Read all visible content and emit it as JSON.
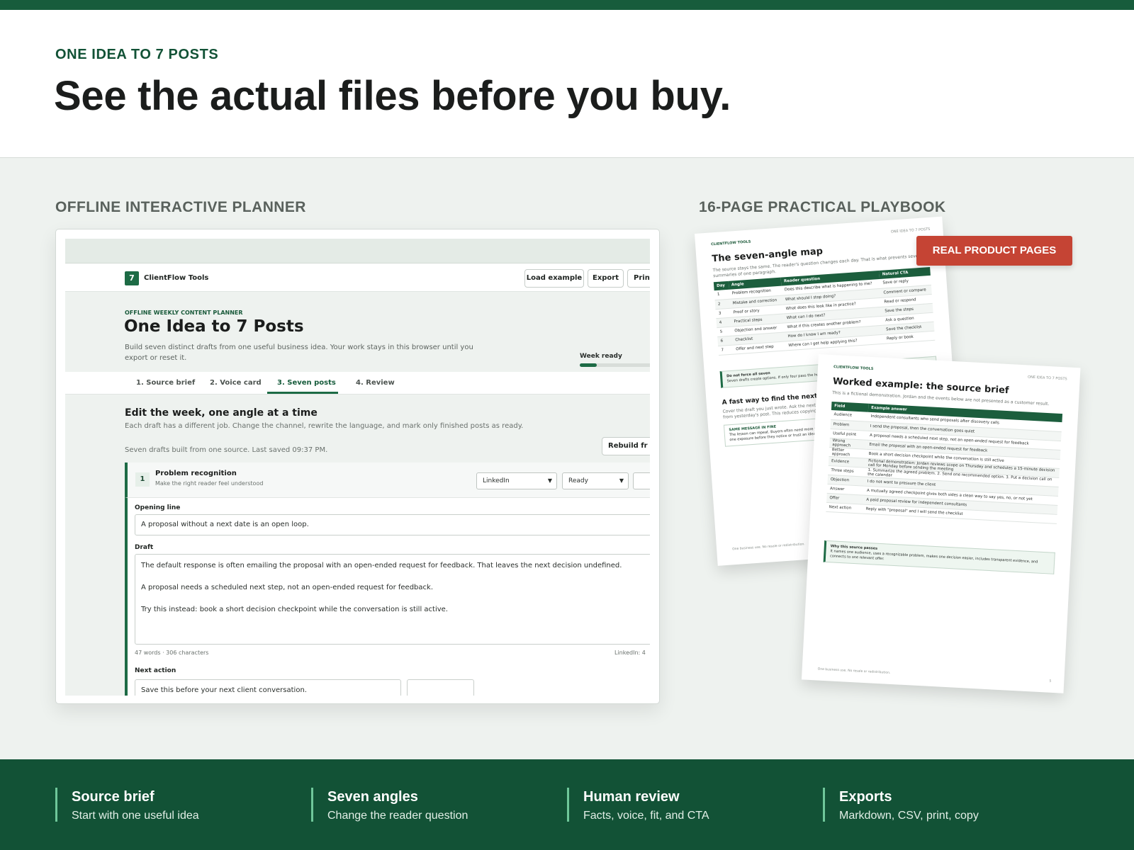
{
  "hero": {
    "eyebrow": "ONE IDEA TO 7 POSTS",
    "headline": "See the actual files before you buy."
  },
  "sections": {
    "planner_label": "OFFLINE INTERACTIVE PLANNER",
    "playbook_label": "16-PAGE PRACTICAL PLAYBOOK"
  },
  "planner": {
    "logo_mark": "7",
    "brand": "ClientFlow Tools",
    "toolbar": {
      "load_example": "Load example",
      "export": "Export",
      "print": "Print"
    },
    "kicker": "OFFLINE WEEKLY CONTENT PLANNER",
    "title": "One Idea to 7 Posts",
    "description": "Build seven distinct drafts from one useful business idea. Your work stays in this browser until you export or reset it.",
    "week_ready_label": "Week ready",
    "week_ready_progress": 0.2,
    "tabs": [
      {
        "label": "1. Source brief"
      },
      {
        "label": "2. Voice card"
      },
      {
        "label": "3. Seven posts"
      },
      {
        "label": "4. Review"
      }
    ],
    "section_title": "Edit the week, one angle at a time",
    "section_sub": "Each draft has a different job. Change the channel, rewrite the language, and mark only finished posts as ready.",
    "saved_status": "Seven drafts built from one source. Last saved 09:37 PM.",
    "rebuild_label": "Rebuild fr",
    "post": {
      "number": "1",
      "title": "Problem recognition",
      "subtitle": "Make the right reader feel understood",
      "channel": "LinkedIn",
      "status": "Ready",
      "opening_label": "Opening line",
      "opening_value": "A proposal without a next date is an open loop.",
      "draft_label": "Draft",
      "draft_paragraphs": [
        "The default response is often emailing the proposal with an open-ended request for feedback. That leaves the next decision undefined.",
        "A proposal needs a scheduled next step, not an open-ended request for feedback.",
        "Try this instead: book a short decision checkpoint while the conversation is still active."
      ],
      "word_count": "47 words · 306 characters",
      "limit_note": "LinkedIn: 4",
      "next_action_label": "Next action",
      "next_action_value": "Save this before your next client conversation."
    }
  },
  "playbook": {
    "badge": "REAL PRODUCT PAGES",
    "page1": {
      "kicker": "CLIENTFLOW TOOLS",
      "ref": "ONE IDEA TO 7 POSTS",
      "title": "The seven-angle map",
      "subtitle": "The source stays the same. The reader's question changes each day. That is what prevents seven summaries of one paragraph.",
      "columns": [
        "Day",
        "Angle",
        "Reader question",
        "Natural CTA"
      ],
      "rows": [
        [
          "1",
          "Problem recognition",
          "Does this describe what is happening to me?",
          "Save or reply"
        ],
        [
          "2",
          "Mistake and correction",
          "What should I stop doing?",
          "Comment or compare"
        ],
        [
          "3",
          "Proof or story",
          "What does this look like in practice?",
          "Read or respond"
        ],
        [
          "4",
          "Practical steps",
          "What can I do next?",
          "Save the steps"
        ],
        [
          "5",
          "Objection and answer",
          "What if this creates another problem?",
          "Ask a question"
        ],
        [
          "6",
          "Checklist",
          "How do I know I am ready?",
          "Save the checklist"
        ],
        [
          "7",
          "Offer and next step",
          "Where can I get help applying this?",
          "Reply or book"
        ]
      ],
      "note_title": "Do not force all seven",
      "note_body": "Seven drafts create options. If only four pass the human review, publish four. Quality beats filling every slot.",
      "section_h": "A fast way to find the next angle",
      "section_p": "Cover the draft you just wrote. Ask the next day's question against the original source brief, not from yesterday's post. This reduces copying.",
      "mini_title": "SAME MESSAGE IN FINE",
      "mini_body": "The lesson can repeat. Buyers often need more than one exposure before they notice or trust an idea.",
      "footer": "One business use. No resale or redistribution."
    },
    "page2": {
      "kicker": "CLIENTFLOW TOOLS",
      "ref": "ONE IDEA TO 7 POSTS",
      "title": "Worked example: the source brief",
      "subtitle": "This is a fictional demonstration. Jordan and the events below are not presented as a customer result.",
      "columns": [
        "Field",
        "Example answer"
      ],
      "rows": [
        [
          "Audience",
          "Independent consultants who send proposals after discovery calls"
        ],
        [
          "Problem",
          "I send the proposal, then the conversation goes quiet"
        ],
        [
          "Useful point",
          "A proposal needs a scheduled next step, not an open-ended request for feedback"
        ],
        [
          "Wrong approach",
          "Email the proposal with an open-ended request for feedback"
        ],
        [
          "Better approach",
          "Book a short decision checkpoint while the conversation is still active"
        ],
        [
          "Evidence",
          "Fictional demonstration: Jordan reviews scope on Thursday and schedules a 15-minute decision call for Monday before sending the meeting"
        ],
        [
          "Three steps",
          "1. Summarize the agreed problem. 2. Send one recommended option. 3. Put a decision call on the calendar"
        ],
        [
          "Objection",
          "I do not want to pressure the client"
        ],
        [
          "Answer",
          "A mutually agreed checkpoint gives both sides a clean way to say yes, no, or not yet"
        ],
        [
          "Offer",
          "A paid proposal review for independent consultants"
        ],
        [
          "Next action",
          "Reply with \"proposal\" and I will send the checklist"
        ]
      ],
      "note_title": "Why this source passes",
      "note_body": "It names one audience, uses a recognizable problem, makes one decision easier, includes transparent evidence, and connects to one relevant offer.",
      "footer": "One business use. No resale or redistribution.",
      "page_number": "5"
    }
  },
  "features": [
    {
      "title": "Source brief",
      "desc": "Start with one useful idea"
    },
    {
      "title": "Seven angles",
      "desc": "Change the reader question"
    },
    {
      "title": "Human review",
      "desc": "Facts, voice, fit, and CTA"
    },
    {
      "title": "Exports",
      "desc": "Markdown, CSV, print, copy"
    }
  ],
  "colors": {
    "brand_green": "#175c3c",
    "footer_green": "#125236",
    "accent_mint": "#6fc79a",
    "badge_red": "#c54434"
  }
}
